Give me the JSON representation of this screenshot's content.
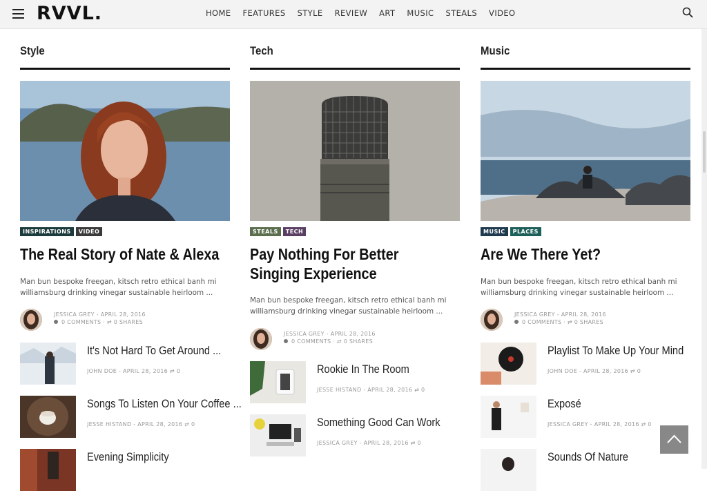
{
  "header": {
    "logo": "RVVL.",
    "nav": [
      "HOME",
      "FEATURES",
      "STYLE",
      "REVIEW",
      "ART",
      "MUSIC",
      "STEALS",
      "VIDEO"
    ]
  },
  "columns": [
    {
      "title": "Style",
      "tags": [
        {
          "label": "INSPIRATIONS",
          "color": "#1c3b3c"
        },
        {
          "label": "VIDEO",
          "color": "#3a3a3a"
        }
      ],
      "headline": "The Real Story of Nate & Alexa",
      "excerpt": "Man bun bespoke freegan, kitsch retro ethical banh mi williamsburg drinking vinegar sustainable heirloom ...",
      "author_meta": "JESSICA GREY - APRIL 28, 2016",
      "social_meta": "0 COMMENTS · ⇄ 0 SHARES",
      "items": [
        {
          "title": "It's Not Hard To Get Around ...",
          "meta": "JOHN DOE - APRIL 28, 2016 ⇄ 0"
        },
        {
          "title": "Songs To Listen On Your Coffee ...",
          "meta": "JESSE HISTAND - APRIL 28, 2016 ⇄ 0"
        },
        {
          "title": "Evening Simplicity",
          "meta": ""
        }
      ]
    },
    {
      "title": "Tech",
      "tags": [
        {
          "label": "STEALS",
          "color": "#5b6e4e"
        },
        {
          "label": "TECH",
          "color": "#5a3e63"
        }
      ],
      "headline": "Pay Nothing For Better Singing Experience",
      "excerpt": "Man bun bespoke freegan, kitsch retro ethical banh mi williamsburg drinking vinegar sustainable heirloom ...",
      "author_meta": "JESSICA GREY - APRIL 28, 2016",
      "social_meta": "0 COMMENTS · ⇄ 0 SHARES",
      "items": [
        {
          "title": "Rookie In The Room",
          "meta": "JESSE HISTAND - APRIL 28, 2016 ⇄ 0"
        },
        {
          "title": "Something Good Can Work",
          "meta": "JESSICA GREY - APRIL 28, 2016 ⇄ 0"
        }
      ]
    },
    {
      "title": "Music",
      "tags": [
        {
          "label": "MUSIC",
          "color": "#1f3a4e"
        },
        {
          "label": "PLACES",
          "color": "#1d5f5a"
        }
      ],
      "headline": "Are We There Yet?",
      "excerpt": "Man bun bespoke freegan, kitsch retro ethical banh mi williamsburg drinking vinegar sustainable heirloom ...",
      "author_meta": "JESSICA GREY - APRIL 28, 2016",
      "social_meta": "0 COMMENTS · ⇄ 0 SHARES",
      "items": [
        {
          "title": "Playlist To Make Up Your Mind",
          "meta": "JOHN DOE - APRIL 28, 2016 ⇄ 0"
        },
        {
          "title": "Exposé",
          "meta": "JESSICA GREY - APRIL 28, 2016 ⇄ 0"
        },
        {
          "title": "Sounds Of Nature",
          "meta": ""
        }
      ]
    }
  ]
}
